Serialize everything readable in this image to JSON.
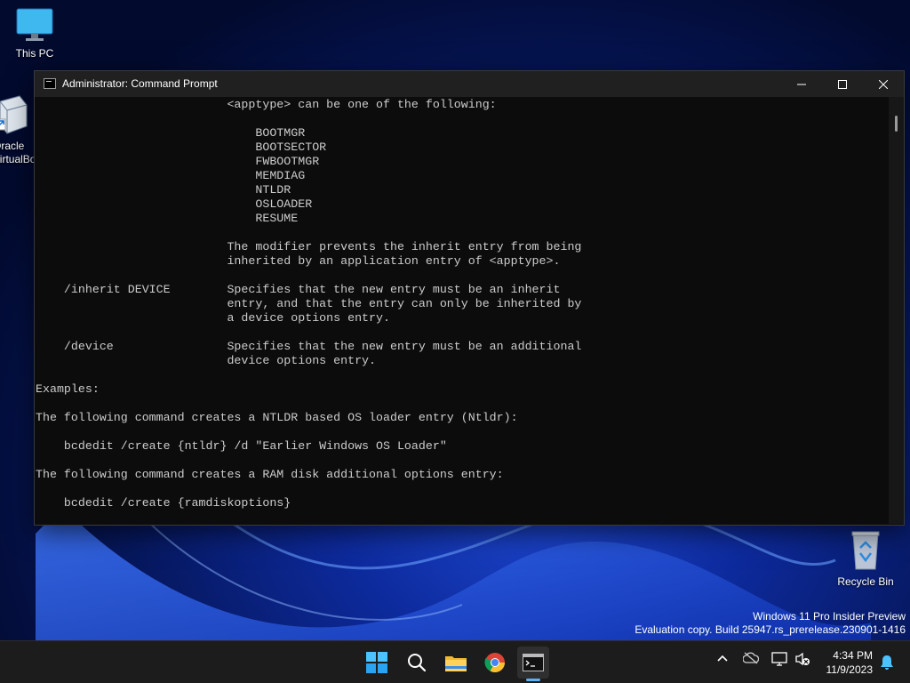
{
  "desktop": {
    "icons": [
      {
        "label": "This PC"
      },
      {
        "label": "Oracle\nVirtualBox"
      },
      {
        "label": "Recycle Bin"
      }
    ]
  },
  "window": {
    "title": "Administrator: Command Prompt",
    "buttons": {
      "minimize": "minimize-icon",
      "maximize": "maximize-icon",
      "close": "close-icon"
    }
  },
  "console": {
    "lines": [
      "                           <apptype> can be one of the following:",
      "",
      "                               BOOTMGR",
      "                               BOOTSECTOR",
      "                               FWBOOTMGR",
      "                               MEMDIAG",
      "                               NTLDR",
      "                               OSLOADER",
      "                               RESUME",
      "",
      "                           The modifier prevents the inherit entry from being",
      "                           inherited by an application entry of <apptype>.",
      "",
      "    /inherit DEVICE        Specifies that the new entry must be an inherit",
      "                           entry, and that the entry can only be inherited by",
      "                           a device options entry.",
      "",
      "    /device                Specifies that the new entry must be an additional",
      "                           device options entry.",
      "",
      "Examples:",
      "",
      "The following command creates a NTLDR based OS loader entry (Ntldr):",
      "",
      "    bcdedit /create {ntldr} /d \"Earlier Windows OS Loader\"",
      "",
      "The following command creates a RAM disk additional options entry:",
      "",
      "    bcdedit /create {ramdiskoptions}",
      ""
    ]
  },
  "watermark": {
    "line1": "Windows 11 Pro Insider Preview",
    "line2": "Evaluation copy. Build 25947.rs_prerelease.230901-1416"
  },
  "taskbar": {
    "apps": [
      "start-icon",
      "search-icon",
      "file-explorer-icon",
      "chrome-icon",
      "command-prompt-icon"
    ],
    "time": "4:34 PM",
    "date": "11/9/2023"
  },
  "colors": {
    "console_bg": "#0c0c0c",
    "console_fg": "#cccccc",
    "titlebar_bg": "#202020",
    "taskbar_bg": "#1c1c1c",
    "accent": "#5fb2f2"
  }
}
